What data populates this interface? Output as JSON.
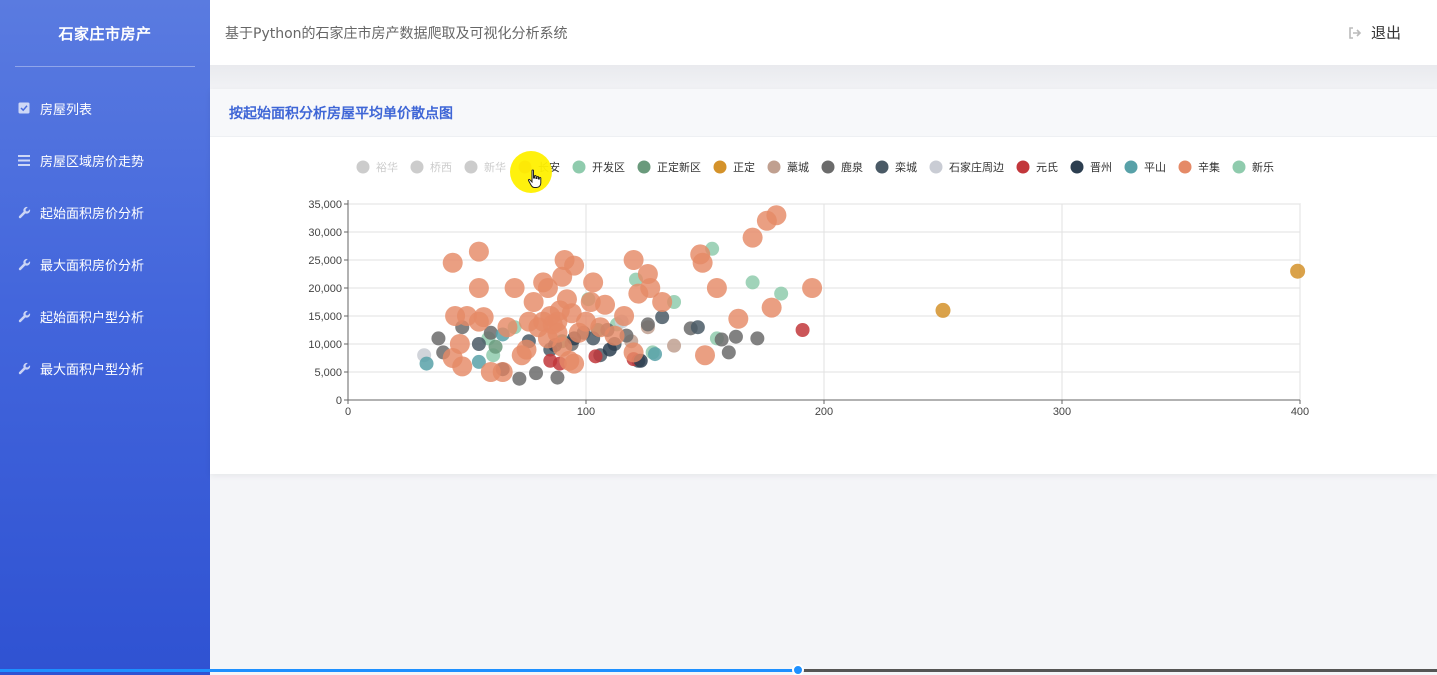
{
  "sidebar": {
    "brand": "石家庄市房产",
    "items": [
      {
        "label": "房屋列表",
        "icon": "checkbox-icon"
      },
      {
        "label": "房屋区域房价走势",
        "icon": "list-icon"
      },
      {
        "label": "起始面积房价分析",
        "icon": "wrench-icon"
      },
      {
        "label": "最大面积房价分析",
        "icon": "wrench-icon"
      },
      {
        "label": "起始面积户型分析",
        "icon": "wrench-icon"
      },
      {
        "label": "最大面积户型分析",
        "icon": "wrench-icon"
      }
    ]
  },
  "header": {
    "title": "基于Python的石家庄市房产数据爬取及可视化分析系统",
    "logout_label": "退出"
  },
  "card": {
    "title": "按起始面积分析房屋平均单价散点图"
  },
  "video_progress": 0.555,
  "chart_data": {
    "type": "scatter",
    "title": "",
    "xlabel": "",
    "ylabel": "",
    "xlim": [
      0,
      400
    ],
    "ylim": [
      0,
      35000
    ],
    "xticks": [
      0,
      100,
      200,
      300,
      400
    ],
    "yticks": [
      0,
      5000,
      10000,
      15000,
      20000,
      25000,
      30000,
      35000
    ],
    "ytick_labels": [
      "0",
      "5,000",
      "10,000",
      "15,000",
      "20,000",
      "25,000",
      "30,000",
      "35,000"
    ],
    "grid": true,
    "legend_position": "top",
    "series": [
      {
        "name": "裕华",
        "color": "#cccccc",
        "disabled": true,
        "points": []
      },
      {
        "name": "桥西",
        "color": "#cccccc",
        "disabled": true,
        "points": []
      },
      {
        "name": "新华",
        "color": "#cccccc",
        "disabled": true,
        "points": []
      },
      {
        "name": "长安",
        "color": "#d96b8c",
        "disabled": false,
        "points": []
      },
      {
        "name": "开发区",
        "color": "#8fcbad",
        "disabled": false,
        "points": [
          [
            153,
            27000
          ],
          [
            170,
            21000
          ],
          [
            182,
            19000
          ],
          [
            101,
            18000
          ],
          [
            137,
            17500
          ],
          [
            121,
            21500
          ],
          [
            59,
            11000
          ],
          [
            155,
            11000
          ],
          [
            70,
            13000
          ],
          [
            61,
            8000
          ],
          [
            128,
            8500
          ],
          [
            113,
            13500
          ]
        ]
      },
      {
        "name": "正定新区",
        "color": "#6a9a7c",
        "disabled": false,
        "points": [
          [
            62,
            9500
          ],
          [
            105,
            12500
          ],
          [
            90,
            10500
          ]
        ]
      },
      {
        "name": "正定",
        "color": "#d4922a",
        "disabled": false,
        "points": [
          [
            250,
            16000
          ],
          [
            399,
            23000
          ]
        ]
      },
      {
        "name": "藁城",
        "color": "#c0a090",
        "disabled": false,
        "points": [
          [
            137,
            9700
          ],
          [
            126,
            13000
          ],
          [
            119,
            10500
          ]
        ]
      },
      {
        "name": "鹿泉",
        "color": "#6b6b6b",
        "disabled": false,
        "points": [
          [
            38,
            11000
          ],
          [
            40,
            8500
          ],
          [
            48,
            13000
          ],
          [
            60,
            12000
          ],
          [
            72,
            3800
          ],
          [
            94,
            10000
          ],
          [
            117,
            11500
          ],
          [
            144,
            12800
          ],
          [
            160,
            8500
          ],
          [
            163,
            11300
          ],
          [
            172,
            11000
          ],
          [
            88,
            4000
          ],
          [
            109,
            12500
          ],
          [
            126,
            13500
          ],
          [
            157,
            10800
          ],
          [
            79,
            4800
          ]
        ]
      },
      {
        "name": "栾城",
        "color": "#4a5a66",
        "disabled": false,
        "points": [
          [
            76,
            10500
          ],
          [
            99,
            12000
          ],
          [
            122,
            7000
          ],
          [
            132,
            14800
          ],
          [
            147,
            13000
          ],
          [
            106,
            8000
          ],
          [
            55,
            10000
          ],
          [
            85,
            9000
          ],
          [
            103,
            11000
          ],
          [
            112,
            10000
          ]
        ]
      },
      {
        "name": "石家庄周边",
        "color": "#c9ccd4",
        "disabled": false,
        "points": [
          [
            32,
            8000
          ],
          [
            115,
            14000
          ]
        ]
      },
      {
        "name": "元氏",
        "color": "#c2373b",
        "disabled": false,
        "points": [
          [
            191,
            12500
          ],
          [
            85,
            7000
          ],
          [
            89,
            6500
          ],
          [
            120,
            7300
          ],
          [
            104,
            7800
          ]
        ]
      },
      {
        "name": "晋州",
        "color": "#2c3e50",
        "disabled": false,
        "points": [
          [
            95,
            11000
          ],
          [
            110,
            9000
          ],
          [
            123,
            7000
          ],
          [
            65,
            5500
          ],
          [
            87,
            9800
          ]
        ]
      },
      {
        "name": "平山",
        "color": "#58a1a8",
        "disabled": false,
        "points": [
          [
            33,
            6500
          ],
          [
            55,
            6800
          ],
          [
            129,
            8200
          ],
          [
            65,
            11700
          ]
        ]
      },
      {
        "name": "辛集",
        "color": "#e58a67",
        "disabled": false,
        "points": [
          [
            44,
            24500
          ],
          [
            55,
            26500
          ],
          [
            55,
            20000
          ],
          [
            70,
            20000
          ],
          [
            45,
            15000
          ],
          [
            50,
            15000
          ],
          [
            55,
            14000
          ],
          [
            57,
            14800
          ],
          [
            47,
            10000
          ],
          [
            44,
            7500
          ],
          [
            48,
            6000
          ],
          [
            60,
            5000
          ],
          [
            65,
            5000
          ],
          [
            67,
            13000
          ],
          [
            78,
            17500
          ],
          [
            82,
            21000
          ],
          [
            84,
            20000
          ],
          [
            85,
            15000
          ],
          [
            88,
            14000
          ],
          [
            90,
            22000
          ],
          [
            91,
            25000
          ],
          [
            95,
            24000
          ],
          [
            92,
            18000
          ],
          [
            94,
            15500
          ],
          [
            88,
            12000
          ],
          [
            86,
            13500
          ],
          [
            80,
            13000
          ],
          [
            76,
            14000
          ],
          [
            75,
            9000
          ],
          [
            73,
            8000
          ],
          [
            84,
            11000
          ],
          [
            90,
            9500
          ],
          [
            93,
            7000
          ],
          [
            95,
            6500
          ],
          [
            100,
            14000
          ],
          [
            102,
            17500
          ],
          [
            103,
            21000
          ],
          [
            108,
            17000
          ],
          [
            116,
            15000
          ],
          [
            120,
            25000
          ],
          [
            122,
            19000
          ],
          [
            126,
            22500
          ],
          [
            127,
            20000
          ],
          [
            132,
            17500
          ],
          [
            148,
            26000
          ],
          [
            149,
            24500
          ],
          [
            155,
            20000
          ],
          [
            150,
            8000
          ],
          [
            164,
            14500
          ],
          [
            170,
            29000
          ],
          [
            176,
            32000
          ],
          [
            180,
            33000
          ],
          [
            178,
            16500
          ],
          [
            195,
            20000
          ],
          [
            112,
            11500
          ],
          [
            106,
            13000
          ],
          [
            82,
            14000
          ],
          [
            89,
            16000
          ],
          [
            97,
            12000
          ],
          [
            120,
            8500
          ]
        ]
      },
      {
        "name": "新乐",
        "color": "#8fcbad",
        "disabled": false,
        "points": []
      }
    ]
  }
}
